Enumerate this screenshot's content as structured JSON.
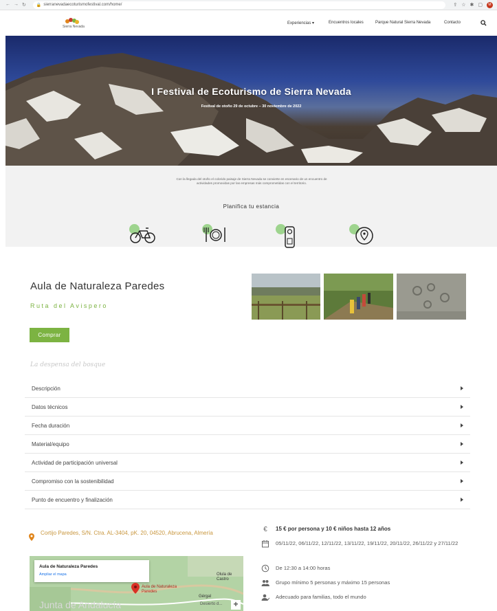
{
  "browser": {
    "url": "sierranevadaecoturismofestival.com/home/"
  },
  "header": {
    "logo_text": "Sierra Nevada",
    "menu": [
      {
        "label": "Experiencias",
        "has_dropdown": true
      },
      {
        "label": "Encuentros locales"
      },
      {
        "label": "Parque Natural Sierra Nevada"
      },
      {
        "label": "Contacto"
      }
    ]
  },
  "hero": {
    "title": "I Festival de Ecoturismo de Sierra Nevada",
    "subtitle": "Festival de otoño 29 de octubre – 30 noviembre de 2022"
  },
  "intro": {
    "text": "Con la llegada del otoño el colorido paisaje de Sierra Nevada se convierte en escenario de un encuentro de actividades promovidas por las empresas más comprometidas con el territorio.",
    "plan_title": "Planifica tu estancia",
    "icons": [
      "bicycle-icon",
      "dining-icon",
      "hotel-doorhanger-icon",
      "map-pin-icon"
    ]
  },
  "activity": {
    "title": "Aula de Naturaleza Paredes",
    "route": "Ruta del Avispero",
    "buy_label": "Comprar",
    "tagline": "La despensa del bosque",
    "accordion": [
      "Descripción",
      "Datos técnicos",
      "Fecha duración",
      "Material/equipo",
      "Actividad de participación universal",
      "Compromiso con la sostenibilidad",
      "Punto de encuentro y finalización"
    ]
  },
  "location": {
    "address": "Cortijo Paredes, S/N. Ctra. AL-3404, pK. 20, 04520, Abrucena, Almería",
    "map": {
      "place_name": "Aula de Naturaleza Paredes",
      "enlarge_link": "Ampliar el mapa",
      "pin_label": "Aula de Naturaleza Paredes",
      "labels": [
        "Olula de Castro",
        "Gérgal",
        "Desierto d..."
      ],
      "zoom_in": "+"
    },
    "watermark": "Junta de Andalucía"
  },
  "details": {
    "price": "15 € por persona y 10 € niños hasta 12 años",
    "dates": "05/11/22, 06/11/22, 12/11/22, 13/11/22, 19/11/22, 20/11/22, 26/11/22 y 27/11/22",
    "hours": "De 12:30 a 14:00 horas",
    "group": "Grupo mínimo 5 personas y máximo 15 personas",
    "audience": "Adecuado para familias, todo el mundo"
  },
  "colors": {
    "accent_green": "#7cb342",
    "address_gold": "#c8963d",
    "pin_orange": "#e0851c"
  }
}
